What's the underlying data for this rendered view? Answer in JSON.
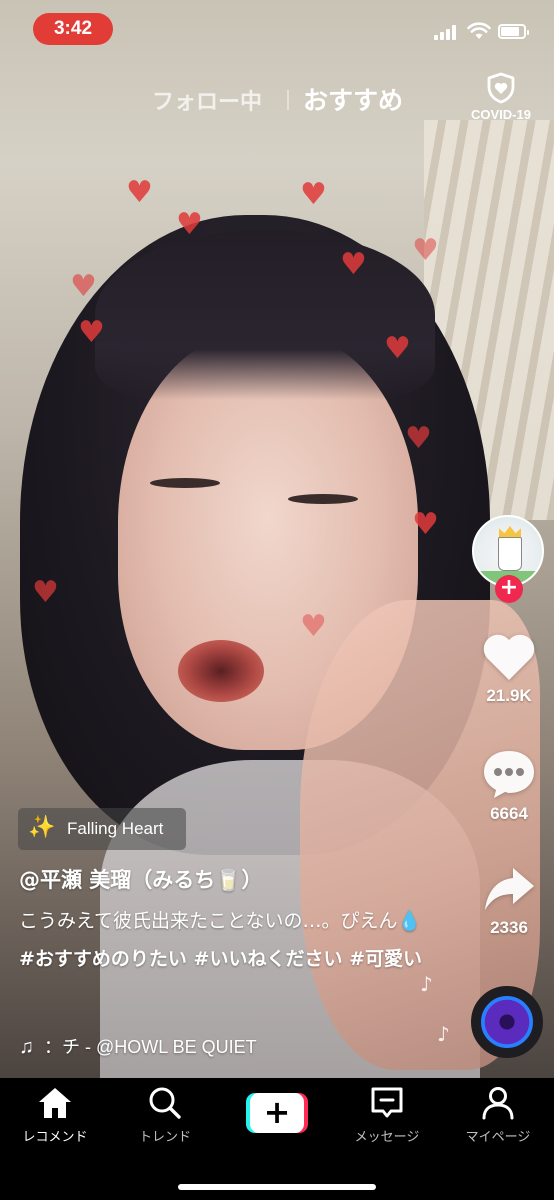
{
  "status_bar": {
    "time": "3:42"
  },
  "top_tabs": {
    "following": "フォロー中",
    "for_you": "おすすめ"
  },
  "covid": {
    "label": "COVID-19"
  },
  "effect": {
    "label": "Falling Heart",
    "icon": "sparkle-wand-icon"
  },
  "post": {
    "username": "@平瀬 美瑠（みるち🥛）",
    "caption_text": "こうみえて彼氏出来たことないの…。ぴえん💧",
    "caption_tags": "#おすすめのりたい #いいねください #可愛い",
    "sound": "：チ - @HOWL BE QUIET"
  },
  "rail": {
    "likes": "21.9K",
    "comments": "6664",
    "shares": "2336"
  },
  "bottom_nav": {
    "items": [
      {
        "label": "レコメンド",
        "icon": "home-icon",
        "active": true
      },
      {
        "label": "トレンド",
        "icon": "search-icon",
        "active": false
      },
      {
        "label": "",
        "icon": "create-plus-icon",
        "active": false
      },
      {
        "label": "メッセージ",
        "icon": "inbox-icon",
        "active": false
      },
      {
        "label": "マイページ",
        "icon": "profile-icon",
        "active": false
      }
    ]
  },
  "colors": {
    "time_pill": "#e23c37",
    "follow_plus": "#f0284f",
    "create_cyan": "#25f4ee",
    "create_red": "#fe2c55"
  }
}
